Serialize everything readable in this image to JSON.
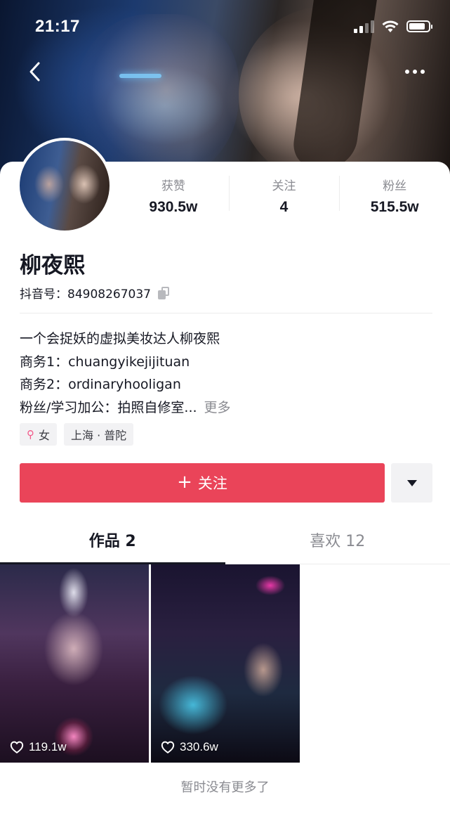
{
  "status_bar": {
    "time": "21:17",
    "icons": [
      "cellular-signal-icon",
      "wifi-icon",
      "battery-icon"
    ],
    "signal_bars_active": 2,
    "battery_level": 0.75
  },
  "nav": {
    "back_icon": "chevron-left-icon",
    "more_icon": "more-horizontal-icon"
  },
  "profile": {
    "name": "柳夜熙",
    "id_label": "抖音号：84908267037",
    "stats": [
      {
        "label": "获赞",
        "value": "930.5w"
      },
      {
        "label": "关注",
        "value": "4"
      },
      {
        "label": "粉丝",
        "value": "515.5w"
      }
    ],
    "bio_lines": [
      "一个会捉妖的虚拟美妆达人柳夜熙",
      "商务1：chuangyikejijituan",
      "商务2：ordinaryhooligan",
      "粉丝/学习加公：拍照自修室..."
    ],
    "bio_more": "更多",
    "tags": [
      {
        "icon": "female-icon",
        "label": "女"
      },
      {
        "label": "上海 · 普陀"
      }
    ]
  },
  "actions": {
    "follow_label": "关注",
    "follow_color": "#ea4459"
  },
  "tabs": [
    {
      "label": "作品 2",
      "active": true
    },
    {
      "label": "喜欢 12",
      "active": false
    }
  ],
  "videos": [
    {
      "likes": "119.1w"
    },
    {
      "likes": "330.6w"
    }
  ],
  "footer": {
    "no_more": "暂时没有更多了"
  }
}
